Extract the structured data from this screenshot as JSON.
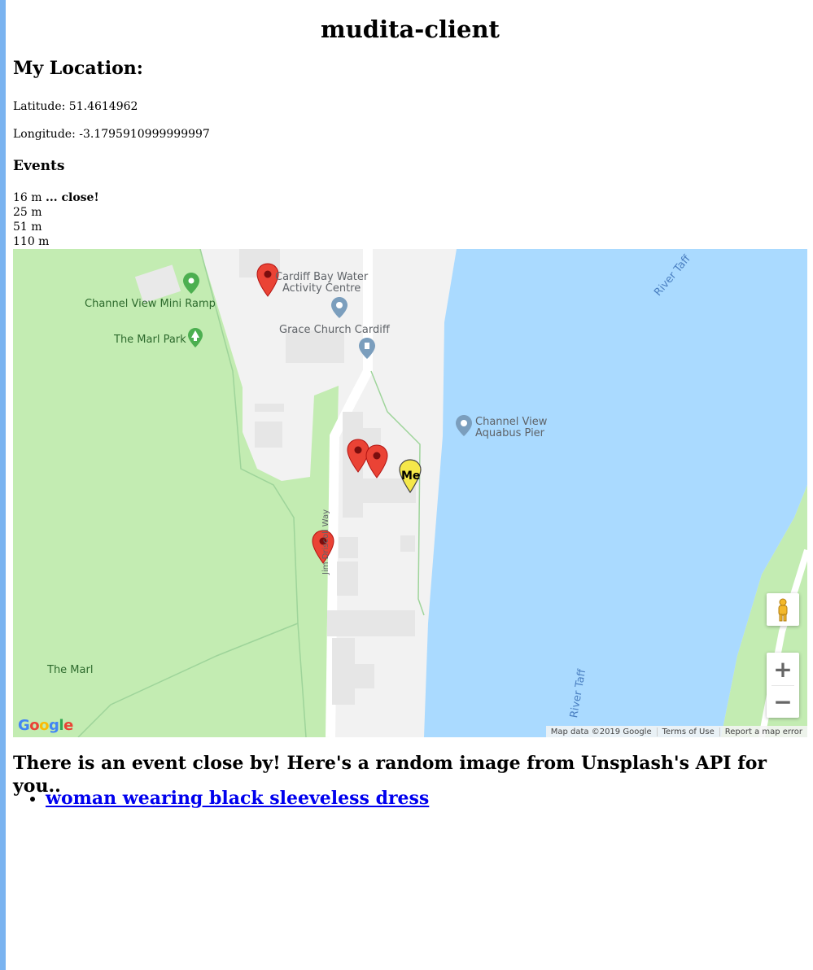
{
  "page": {
    "title": "mudita-client"
  },
  "location": {
    "heading": "My Location:",
    "latitude_label": "Latitude: 51.4614962",
    "longitude_label": "Longitude: -3.1795910999999997"
  },
  "events": {
    "heading": "Events",
    "items": [
      {
        "distance": "16 m",
        "note": "... close!"
      },
      {
        "distance": "25 m",
        "note": ""
      },
      {
        "distance": "51 m",
        "note": ""
      },
      {
        "distance": "110 m",
        "note": ""
      }
    ]
  },
  "map": {
    "labels": {
      "water_centre": "Cardiff Bay Water\nActivity Centre",
      "mini_ramp": "Channel View Mini Ramp",
      "marl_park": "The Marl Park",
      "grace_church": "Grace Church Cardiff",
      "aquabus": "Channel View\nAquabus Pier",
      "river_taff_top": "River Taff",
      "river_taff_bottom": "River Taff",
      "the_marl": "The Marl",
      "road": "Jim Driscoll Way"
    },
    "me_label": "Me",
    "attribution": {
      "data": "Map data ©2019 Google",
      "terms": "Terms of Use",
      "report": "Report a map error"
    },
    "logo": "Google",
    "zoom_in": "+",
    "zoom_out": "−",
    "colors": {
      "park": "#c3ecb2",
      "water": "#aadaff",
      "land": "#f2f2f2",
      "marker": "#ea4335",
      "me_marker": "#f5e84a"
    }
  },
  "notice": "There is an event close by! Here's a random image from Unsplash's API for you..",
  "images": [
    {
      "alt": "woman wearing black sleeveless dress"
    }
  ]
}
